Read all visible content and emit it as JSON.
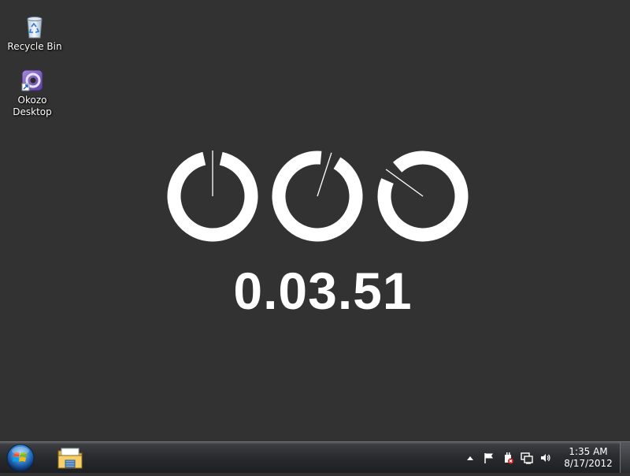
{
  "desktop": {
    "icons": [
      {
        "label": "Recycle Bin",
        "icon": "recycle-bin-icon"
      },
      {
        "label_line1": "Okozo",
        "label_line2": "Desktop",
        "icon": "okozo-desktop-icon"
      }
    ]
  },
  "clock": {
    "readout": "0.03.51",
    "dial_color": "#ffffff",
    "dials": [
      {
        "name": "hours",
        "value": 0
      },
      {
        "name": "minutes",
        "value": 3
      },
      {
        "name": "seconds",
        "value": 51
      }
    ]
  },
  "taskbar": {
    "start_icon": "windows-orb-icon",
    "pinned": [
      {
        "icon": "windows-explorer-icon"
      }
    ],
    "tray": {
      "icons": [
        "show-hidden-icons-arrow",
        "action-center-flag-icon",
        "power-icon",
        "network-icon",
        "volume-icon"
      ],
      "time": "1:35 AM",
      "date": "8/17/2012"
    }
  },
  "colors": {
    "desktop_background": "#323232",
    "taskbar": "#1d1f22",
    "accent": "#ffffff"
  }
}
